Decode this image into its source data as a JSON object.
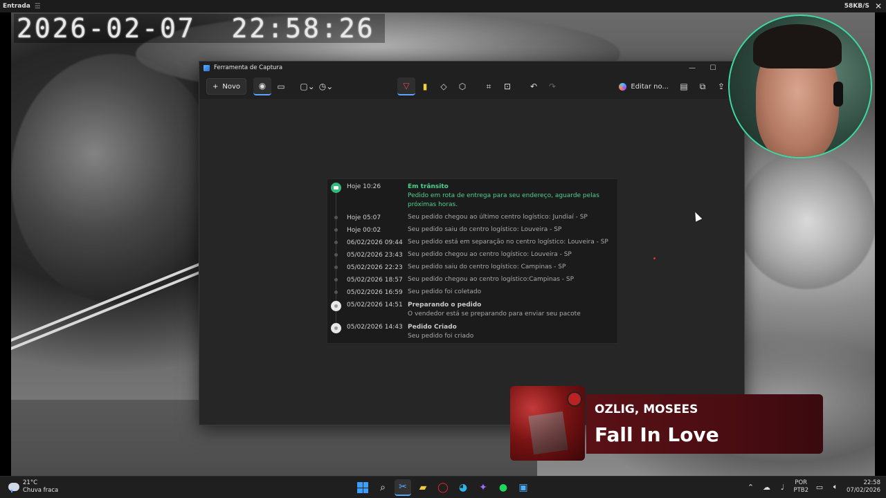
{
  "source_window": {
    "title": "Entrada",
    "net_speed": "58KB/S"
  },
  "camera": {
    "timestamp": "2026-02-07  22:58:26"
  },
  "snip_window": {
    "title": "Ferramenta de Captura",
    "new_label": "Novo",
    "edit_label": "Editar no..."
  },
  "timeline": [
    {
      "date": "Hoje 10:26",
      "status": "Em trânsito",
      "text": "Pedido em rota de entrega para seu endereço, aguarde pelas próximas horas."
    },
    {
      "date": "Hoje 05:07",
      "text": "Seu pedido chegou ao último centro logístico: Jundiaí - SP"
    },
    {
      "date": "Hoje 00:02",
      "text": "Seu pedido saiu do centro logístico: Louveira - SP"
    },
    {
      "date": "06/02/2026 09:44",
      "text": "Seu pedido está em separação no centro logístico: Louveira - SP"
    },
    {
      "date": "05/02/2026 23:43",
      "text": "Seu pedido chegou ao centro logístico: Louveira - SP"
    },
    {
      "date": "05/02/2026 22:23",
      "text": "Seu pedido saiu do centro logístico: Campinas - SP"
    },
    {
      "date": "05/02/2026 18:57",
      "text": "Seu pedido chegou ao centro logístico:Campinas - SP"
    },
    {
      "date": "05/02/2026 16:59",
      "text": "Seu pedido foi coletado"
    },
    {
      "date": "05/02/2026 14:51",
      "status": "Preparando o pedido",
      "text": "O vendedor está se preparando para enviar seu pacote"
    },
    {
      "date": "05/02/2026 14:43",
      "status": "Pedido Criado",
      "text": "Seu pedido foi criado"
    }
  ],
  "now_playing": {
    "artist": "OZLIG, MOSEES",
    "title": "Fall In Love"
  },
  "taskbar": {
    "weather_temp": "21°C",
    "weather_desc": "Chuva fraca",
    "lang": "POR",
    "layout": "PTB2",
    "time": "22:58",
    "date": "07/02/2026"
  },
  "colors": {
    "accent": "#5aa7ff",
    "status_green": "#4fd08f",
    "webcam_ring": "#3dd9a0"
  }
}
